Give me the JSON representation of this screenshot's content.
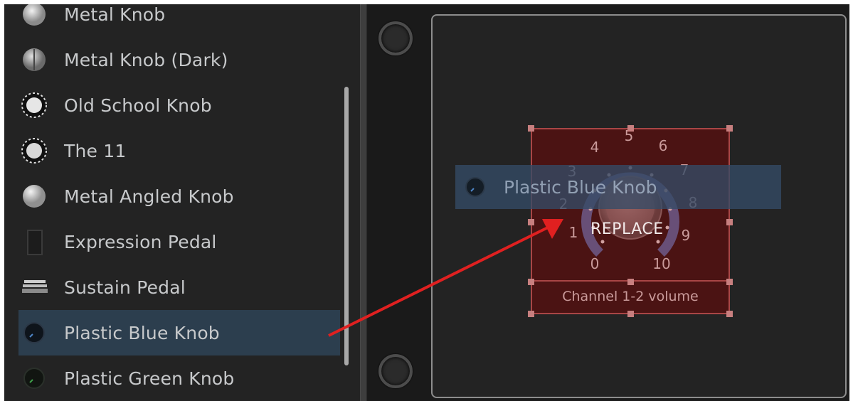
{
  "sidebar": {
    "items": [
      {
        "label": "Metal Knob",
        "icon": "metal-knob-icon",
        "selected": false
      },
      {
        "label": "Metal Knob (Dark)",
        "icon": "metal-knob-dark-icon",
        "selected": false
      },
      {
        "label": "Old School Knob",
        "icon": "old-school-knob-icon",
        "selected": false
      },
      {
        "label": "The 11",
        "icon": "the-11-knob-icon",
        "selected": false
      },
      {
        "label": "Metal Angled Knob",
        "icon": "metal-angled-knob-icon",
        "selected": false
      },
      {
        "label": "Expression Pedal",
        "icon": "expression-pedal-icon",
        "selected": false
      },
      {
        "label": "Sustain Pedal",
        "icon": "sustain-pedal-icon",
        "selected": false
      },
      {
        "label": "Plastic Blue Knob",
        "icon": "plastic-blue-knob-icon",
        "selected": true
      },
      {
        "label": "Plastic Green Knob",
        "icon": "plastic-green-knob-icon",
        "selected": false
      }
    ]
  },
  "drag_preview": {
    "label": "Plastic Blue Knob",
    "icon": "plastic-blue-knob-icon"
  },
  "widget": {
    "label": "Channel 1-2 volume",
    "scale": [
      "0",
      "1",
      "2",
      "3",
      "4",
      "5",
      "6",
      "7",
      "8",
      "9",
      "10"
    ],
    "drop_hint": "REPLACE"
  },
  "colors": {
    "selection": "#2c3e4e",
    "widget_fill": "#4b1313",
    "widget_border": "#a84646",
    "arrow": "#e02020"
  }
}
